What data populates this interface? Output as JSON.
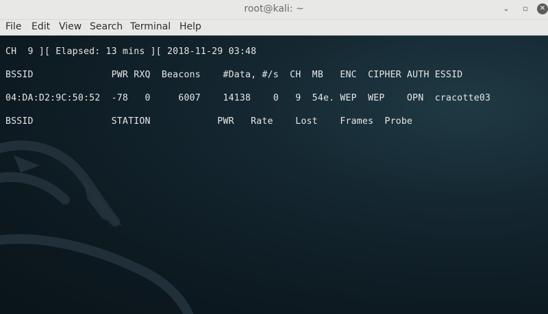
{
  "window": {
    "title": "root@kali: ~",
    "minimize_glyph": "⌄",
    "maximize_glyph": "▫",
    "close_glyph": "✕"
  },
  "menu": [
    "File",
    "Edit",
    "View",
    "Search",
    "Terminal",
    "Help"
  ],
  "terminal": {
    "status_line": "CH  9 ][ Elapsed: 13 mins ][ 2018-11-29 03:48",
    "ap_header": "BSSID              PWR RXQ  Beacons    #Data, #/s  CH  MB   ENC  CIPHER AUTH ESSID",
    "ap_rows": [
      "04:DA:D2:9C:50:52  -78   0     6007    14138    0   9  54e. WEP  WEP    OPN  cracotte03"
    ],
    "station_header": "BSSID              STATION            PWR   Rate    Lost    Frames  Probe"
  },
  "colors": {
    "titlebar_bg": "#e8e8e7",
    "terminal_bg": "#0d1a21",
    "terminal_fg": "#e6e6e6"
  },
  "icons": {
    "background": "kali-dragon-icon"
  }
}
